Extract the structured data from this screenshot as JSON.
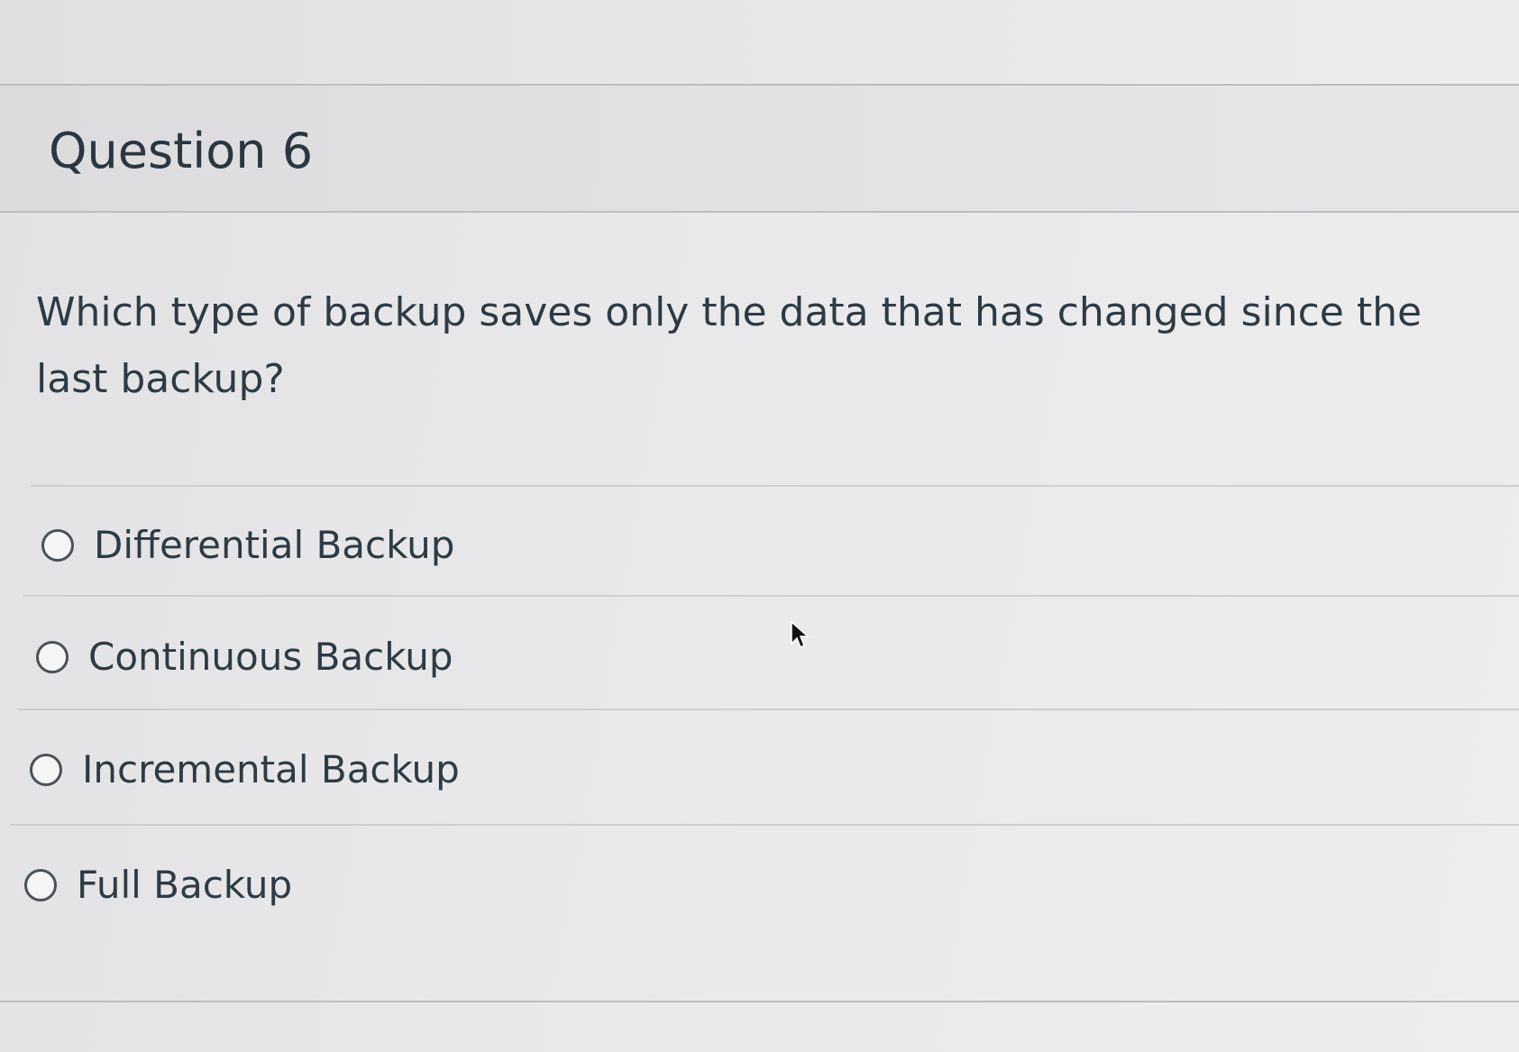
{
  "question": {
    "title": "Question 6",
    "text": "Which type of backup saves only the data that has changed since the last backup?"
  },
  "answers": [
    {
      "label": "Differential Backup",
      "selected": false
    },
    {
      "label": "Continuous Backup",
      "selected": false
    },
    {
      "label": "Incremental Backup",
      "selected": false
    },
    {
      "label": "Full Backup",
      "selected": false
    }
  ],
  "icons": {
    "radio": "radio-button-unchecked-icon",
    "cursor": "mouse-pointer-icon"
  },
  "colors": {
    "text": "#2d3b45",
    "radio_border": "#4a5257",
    "divider": "#bdbdc0"
  }
}
